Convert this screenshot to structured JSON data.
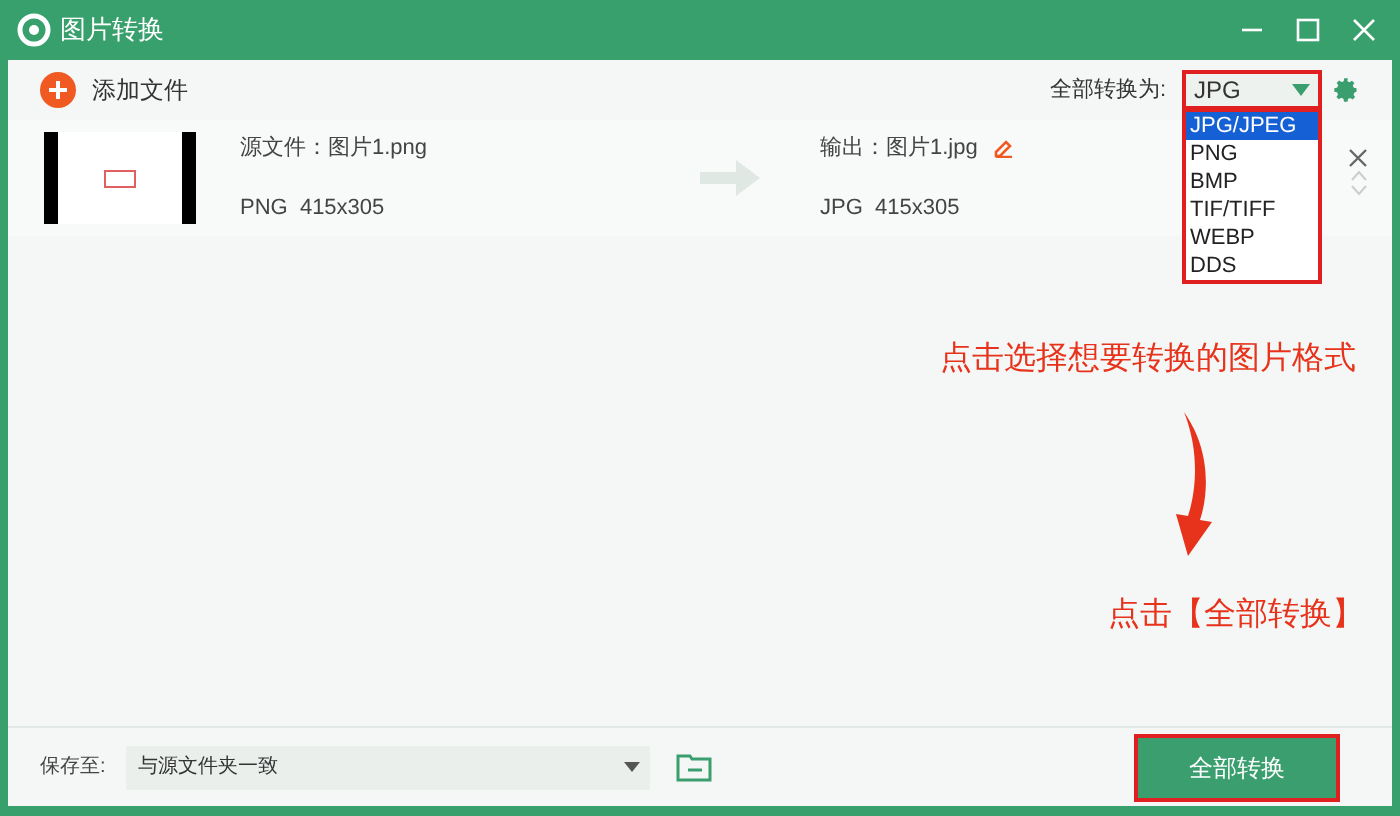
{
  "window": {
    "title": "图片转换"
  },
  "toolbar": {
    "add_label": "添加文件",
    "convert_all_label": "全部转换为:",
    "format_value": "JPG"
  },
  "format_options": [
    {
      "label": "JPG/JPEG",
      "selected": true
    },
    {
      "label": "PNG",
      "selected": false
    },
    {
      "label": "BMP",
      "selected": false
    },
    {
      "label": "TIF/TIFF",
      "selected": false
    },
    {
      "label": "WEBP",
      "selected": false
    },
    {
      "label": "DDS",
      "selected": false
    }
  ],
  "files": [
    {
      "source": "源文件：图片1.png",
      "source_info": "PNG  415x305",
      "output": "输出：图片1.jpg",
      "output_info": "JPG  415x305"
    }
  ],
  "annotations": [
    {
      "text": "点击选择想要转换的图片格式"
    },
    {
      "text": "点击【全部转换】"
    }
  ],
  "footer": {
    "save_label": "保存至:",
    "save_value": "与源文件夹一致",
    "button": "全部转换"
  }
}
